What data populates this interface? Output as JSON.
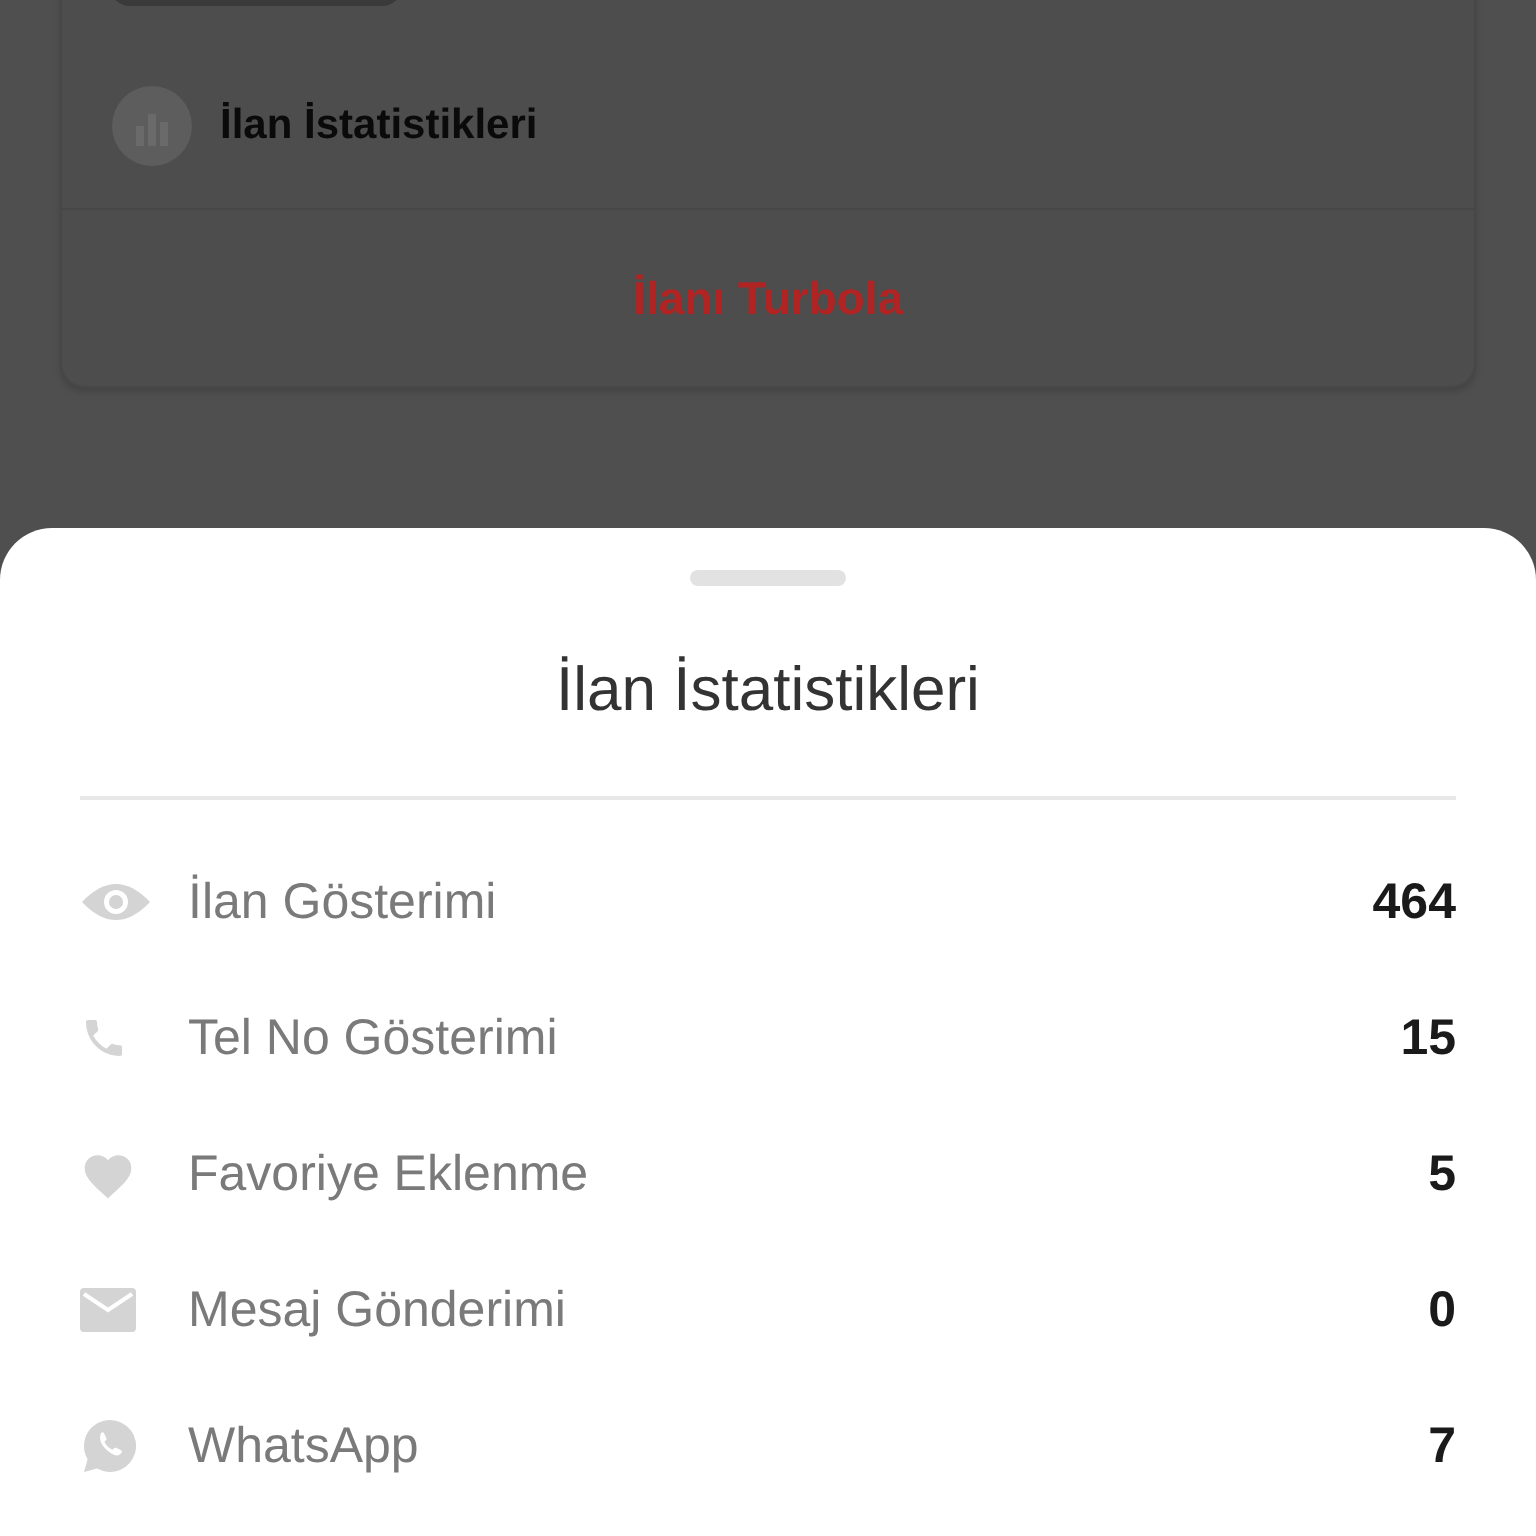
{
  "card": {
    "stat_link": "İlan İstatistikleri",
    "turbo_button": "İlanı Turbola"
  },
  "sheet": {
    "title": "İlan İstatistikleri",
    "rows": [
      {
        "kind": "views",
        "label": "İlan Gösterimi",
        "value": "464"
      },
      {
        "kind": "calls",
        "label": "Tel No Gösterimi",
        "value": "15"
      },
      {
        "kind": "favorites",
        "label": "Favoriye Eklenme",
        "value": "5"
      },
      {
        "kind": "messages",
        "label": "Mesaj Gönderimi",
        "value": "0"
      },
      {
        "kind": "whatsapp",
        "label": "WhatsApp",
        "value": "7"
      }
    ]
  }
}
